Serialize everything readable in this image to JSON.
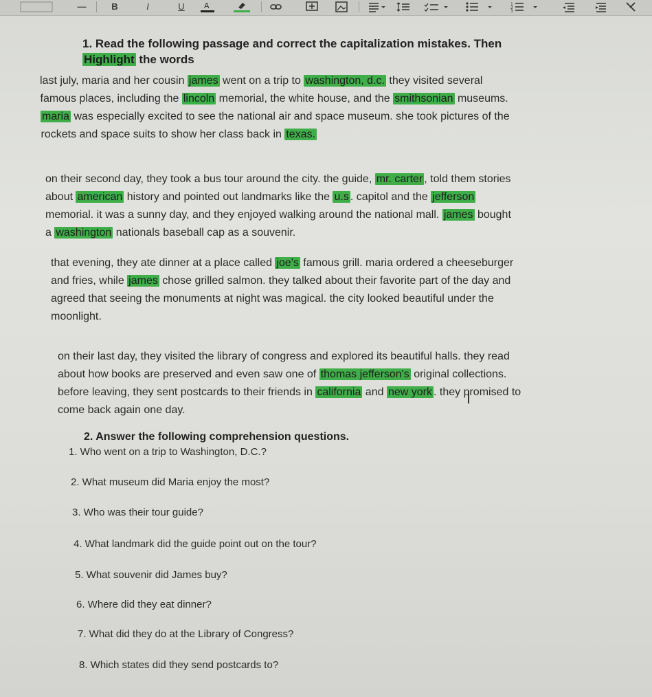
{
  "toolbar": {
    "buttons": [
      {
        "name": "strikethrough-icon",
        "glyph": "S"
      },
      {
        "name": "bold-icon",
        "glyph": "B"
      },
      {
        "name": "italic-icon",
        "glyph": "I"
      },
      {
        "name": "underline-icon",
        "glyph": "U"
      },
      {
        "name": "text-color-icon",
        "glyph": "A"
      },
      {
        "name": "highlight-color-icon",
        "glyph": "✎"
      },
      {
        "name": "link-icon",
        "glyph": "⛓"
      },
      {
        "name": "insert-comment-icon",
        "glyph": "+"
      },
      {
        "name": "insert-image-icon",
        "glyph": "▣"
      },
      {
        "name": "align-icon",
        "glyph": "≡"
      },
      {
        "name": "line-spacing-icon",
        "glyph": "↕"
      },
      {
        "name": "checklist-icon",
        "glyph": "✓"
      },
      {
        "name": "bulleted-list-icon",
        "glyph": "•"
      },
      {
        "name": "numbered-list-icon",
        "glyph": "1"
      },
      {
        "name": "decrease-indent-icon",
        "glyph": "⇤"
      },
      {
        "name": "increase-indent-icon",
        "glyph": "⇥"
      },
      {
        "name": "clear-formatting-icon",
        "glyph": "✕"
      }
    ]
  },
  "task1": {
    "heading_line1": "1. Read the following passage and correct the capitalization mistakes. Then",
    "heading_highlight": "Highlight",
    "heading_line2_rest": " the words"
  },
  "passage": {
    "p1": [
      [
        "last july, maria and her cousin ",
        {
          "hl": "james"
        },
        " went on a trip to ",
        {
          "hl": "washington, d.c."
        },
        " they visited several"
      ],
      [
        "famous places, including the ",
        {
          "hl": "lincoln"
        },
        " memorial, the white house, and the ",
        {
          "hl": "smithsonian"
        },
        " museums."
      ],
      [
        {
          "hl": "maria"
        },
        " was especially excited to see the national air and space museum. she took pictures of the"
      ],
      [
        "rockets and space suits to show her class back in ",
        {
          "hl": "texas."
        }
      ]
    ],
    "p2": [
      [
        "on their second day, they took a bus tour around the city. the guide, ",
        {
          "hl": "mr. carter"
        },
        ", told them stories"
      ],
      [
        "about ",
        {
          "hl": "american"
        },
        " history and pointed out landmarks like the ",
        {
          "hl": "u.s"
        },
        ". capitol and the ",
        {
          "hl": "jefferson"
        }
      ],
      [
        "memorial. it was a sunny day, and they enjoyed walking around the national mall. ",
        {
          "hl": "james"
        },
        " bought"
      ],
      [
        "a ",
        {
          "hl": "washington"
        },
        " nationals baseball cap as a souvenir."
      ]
    ],
    "p3": [
      [
        "that evening, they ate dinner at a place called ",
        {
          "hl": "joe's"
        },
        " famous grill. maria ordered a cheeseburger"
      ],
      [
        "and fries, while ",
        {
          "hl": "james"
        },
        " chose grilled salmon. they talked about their favorite part of the day and"
      ],
      [
        "agreed that seeing the monuments at night was magical. the city looked beautiful under the"
      ],
      [
        "moonlight."
      ]
    ],
    "p4": [
      [
        "on their last day, they visited the library of congress and explored its beautiful halls. they read"
      ],
      [
        "about how books are preserved and even saw one of ",
        {
          "hl": "thomas jefferson's"
        },
        " original collections."
      ],
      [
        "before leaving, they sent postcards to their friends in ",
        {
          "hl": "california"
        },
        " and ",
        {
          "hl": "new york"
        },
        ". they promised to"
      ],
      [
        "come back again one day."
      ]
    ]
  },
  "task2": {
    "heading": "2. Answer the following comprehension questions.",
    "questions": [
      "1. Who went on a trip to Washington, D.C.?",
      "2. What museum did Maria enjoy the most?",
      "3. Who was their tour guide?",
      "4. What landmark did the guide point out on the tour?",
      "5. What souvenir did James buy?",
      "6. Where did they eat dinner?",
      "7. What did they do at the Library of Congress?",
      "8. Which states did they send postcards to?"
    ]
  }
}
